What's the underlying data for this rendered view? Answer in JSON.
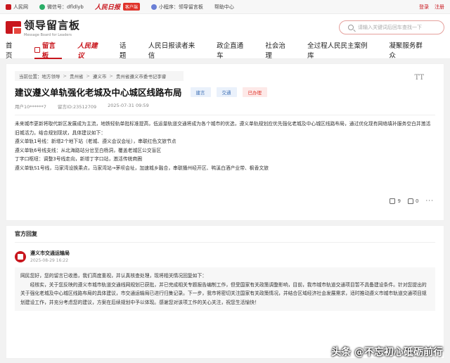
{
  "topbar": {
    "items": [
      {
        "icon": "people-square-icon",
        "label": "人民网",
        "color": "#c8161d"
      },
      {
        "icon": "wechat-icon",
        "label": "微信号：dfldlyb",
        "color": "#2aae67"
      },
      {
        "icon": "app-icon",
        "logo": "人民日报",
        "badge": "客户端"
      },
      {
        "icon": "miniprogram-icon",
        "label": "小程序：领导留言板",
        "color": "#6a7fd6"
      },
      {
        "label": "帮助中心"
      }
    ],
    "login": "登录",
    "register": "注册"
  },
  "header": {
    "logo_cn": "领导留言板",
    "logo_en": "Message Board for Leaders",
    "search_placeholder": "请输入关键词后回车查找一下"
  },
  "nav": {
    "items": [
      {
        "label": "首页"
      },
      {
        "label": "留言板",
        "active": true
      },
      {
        "label": "人民建议",
        "brand": true
      },
      {
        "label": "话题"
      },
      {
        "label": "人民日报读者来信"
      },
      {
        "label": "政企直通车"
      },
      {
        "label": "社会治理"
      },
      {
        "label": "全过程人民民主案例库"
      },
      {
        "label": "凝聚服务群众"
      }
    ]
  },
  "post": {
    "breadcrumb": [
      "当前位置：地方领导",
      "贵州省",
      "遵义市",
      "贵州省遵义市委书记李睿"
    ],
    "font_toggle": "TT",
    "title": "建议遵义单轨强化老城及中心城区线路布局",
    "tags": [
      {
        "label": "建言",
        "color": "blue"
      },
      {
        "label": "交通",
        "color": "blue"
      },
      {
        "label": "已办理",
        "color": "red"
      }
    ],
    "user": "用户10******7",
    "msg_id": "留言ID:23512709",
    "time": "2025-07-31 09:59",
    "body": [
      "未来城市更新将取代新区发展成为主流，地铁轻轨单批标准提高，低运量轨道交通将成为各个城市的优选，遵义单轨规划应优先强化老城及中心城区线路布局，通过优化现有网络填补服务空白并激活旧城活力。结合规划现状，具体建议如下：",
      "遵义单轨1号线：新增2个地下站（老城、遵义会议会址），串联红色文旅节点",
      "遵义单轨6号线支线：从北海路站分岔至白杨洞，覆盖老城区公交盲区",
      "丁字口枢纽：调整3号线走向，新增丁字口站，激活传统商圈",
      "遵义单轨S1号线，马家湾设换乘点，马家湾站→茅坝会址，加速城乡融合，串联播州经开区、鸭溪白酒产业带、枫香文旅"
    ],
    "likes": "9",
    "dislikes": "0",
    "more": "···"
  },
  "reply": {
    "header": "官方回复",
    "org": "遵义市交通运输局",
    "time": "2025-08-29 16:22",
    "text": [
      "网民您好，您的留言已收悉，我们高度重视，并认真核查处理，现将相关情况回复如下：",
      "经核实，关于您反映的遵义市城市轨道交通线网规划已获批，并已完成相关专题报告编制工作，但受国家有关政策调整影响，目前，我市城市轨道交通项目暂不具备建设条件。针对您提出的关于强化老城及中心城区线路布局的具体建议，市交通运输局已进行归集记录。下一步，我市将密切关注国家有关政策情况，并结合区域经济社会发展需求，适时推动遵义市城市轨道交通项目规划建设工作，并充分考虑您的建议，方案在后续规划中予以体现。感谢您对该项工作的关心关注，祝您生活愉快！"
    ]
  },
  "watermark": "头条 @不忘初心砥砺前行"
}
